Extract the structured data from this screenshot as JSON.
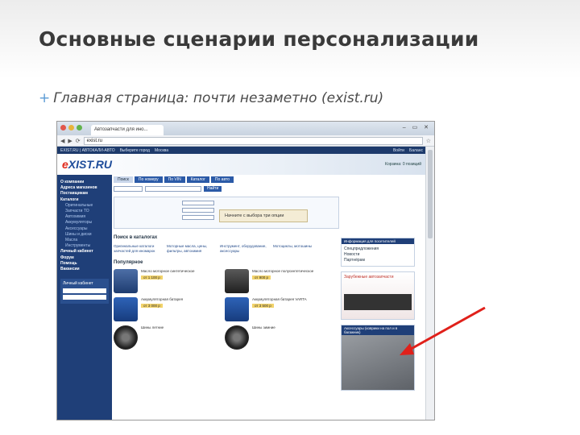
{
  "slide": {
    "title": "Основные сценарии персонализации",
    "bullet_marker": "+",
    "bullet_text": "Главная страница: почти незаметно (exist.ru)"
  },
  "browser": {
    "tab_title": "Автозапчасти для ино...",
    "url": "exist.ru",
    "window_controls": "– ▭ ✕"
  },
  "site": {
    "topnav": [
      "EXIST.RU | АВТОКАЛИ-АВТО",
      "Выберите город",
      "Москва",
      "Войти",
      "Баланс"
    ],
    "logo_prefix": "e",
    "logo_rest": "XIST.RU",
    "cart_text": "Корзина: 0 позиций",
    "menu_items": [
      {
        "label": "О компании",
        "type": "hd"
      },
      {
        "label": "Адреса магазинов",
        "type": "hd"
      },
      {
        "label": "Поставщикам",
        "type": "hd"
      },
      {
        "label": "Каталоги",
        "type": "hd"
      },
      {
        "label": "Оригинальные",
        "type": "sub"
      },
      {
        "label": "Запчасти ТО",
        "type": "sub"
      },
      {
        "label": "Автохимия",
        "type": "sub"
      },
      {
        "label": "Аккумуляторы",
        "type": "sub"
      },
      {
        "label": "Аксессуары",
        "type": "sub"
      },
      {
        "label": "Шины и диски",
        "type": "sub"
      },
      {
        "label": "Масла",
        "type": "sub"
      },
      {
        "label": "Инструменты",
        "type": "sub"
      },
      {
        "label": "Личный кабинет",
        "type": "hd"
      },
      {
        "label": "Форум",
        "type": "hd"
      },
      {
        "label": "Помощь",
        "type": "hd"
      },
      {
        "label": "Вакансии",
        "type": "hd"
      }
    ],
    "login_box_title": "Личный кабинет",
    "search_tabs": [
      "Поиск",
      "По номеру",
      "По VIN",
      "Каталог",
      "По авто"
    ],
    "search_button": "Найти",
    "car_hint": "Начните с выбора три опции",
    "catalog_section_title": "Поиск в каталогах",
    "catalog_columns": [
      "Оригинальные каталоги запчастей для иномарок",
      "Моторные масла, цены, фильтры, автохимия",
      "Инструмент, оборудование, аксессуары",
      "Мотоциклы, мотошины"
    ],
    "popular_section_title": "Популярное",
    "products": [
      {
        "name": "Масло моторное синтетическое",
        "price": "от 1 100 р"
      },
      {
        "name": "Масло моторное полусинтетическое",
        "price": "от 900 р"
      },
      {
        "name": "Аккумуляторная батарея",
        "price": "от 3 000 р"
      },
      {
        "name": "Аккумуляторная батарея VARTA",
        "price": "от 3 500 р"
      },
      {
        "name": "Шины летние",
        "price": ""
      },
      {
        "name": "Шины зимние",
        "price": ""
      }
    ],
    "side_panel_title": "Информация для посетителей",
    "side_panel_items": [
      "Спецпредложения",
      "Новости",
      "Партнёрам"
    ],
    "ad1_title": "Зарубежные автозапчасти",
    "ad2_title": "Аксессуары (коврики на пол и в багажник)"
  },
  "colors": {
    "title": "#3a3a3a",
    "accent": "#5b9bd5",
    "site_blue": "#1f3f78",
    "arrow": "#e0201a"
  }
}
